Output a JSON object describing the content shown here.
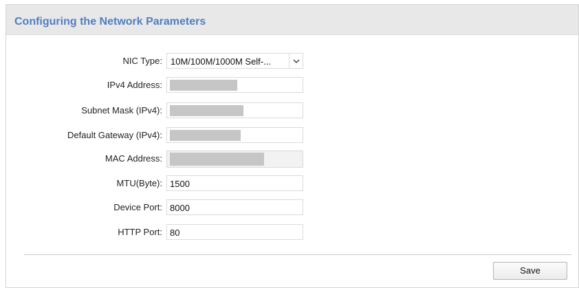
{
  "header": {
    "title": "Configuring the Network Parameters"
  },
  "form": {
    "nic_type": {
      "label": "NIC Type:",
      "value": "10M/100M/1000M Self-..."
    },
    "ipv4_address": {
      "label": "IPv4 Address:"
    },
    "subnet_mask": {
      "label": "Subnet Mask (IPv4):"
    },
    "default_gateway": {
      "label": "Default Gateway (IPv4):"
    },
    "mac_address": {
      "label": "MAC Address:"
    },
    "mtu": {
      "label": "MTU(Byte):",
      "value": "1500"
    },
    "device_port": {
      "label": "Device Port:",
      "value": "8000"
    },
    "http_port": {
      "label": "HTTP Port:",
      "value": "80"
    }
  },
  "footer": {
    "save_label": "Save"
  },
  "colors": {
    "title": "#4f7fc1",
    "header_bg": "#e8e8e8",
    "redaction": "#c6c6c6"
  },
  "icons": {
    "select_arrow": "chevron-down-icon"
  }
}
